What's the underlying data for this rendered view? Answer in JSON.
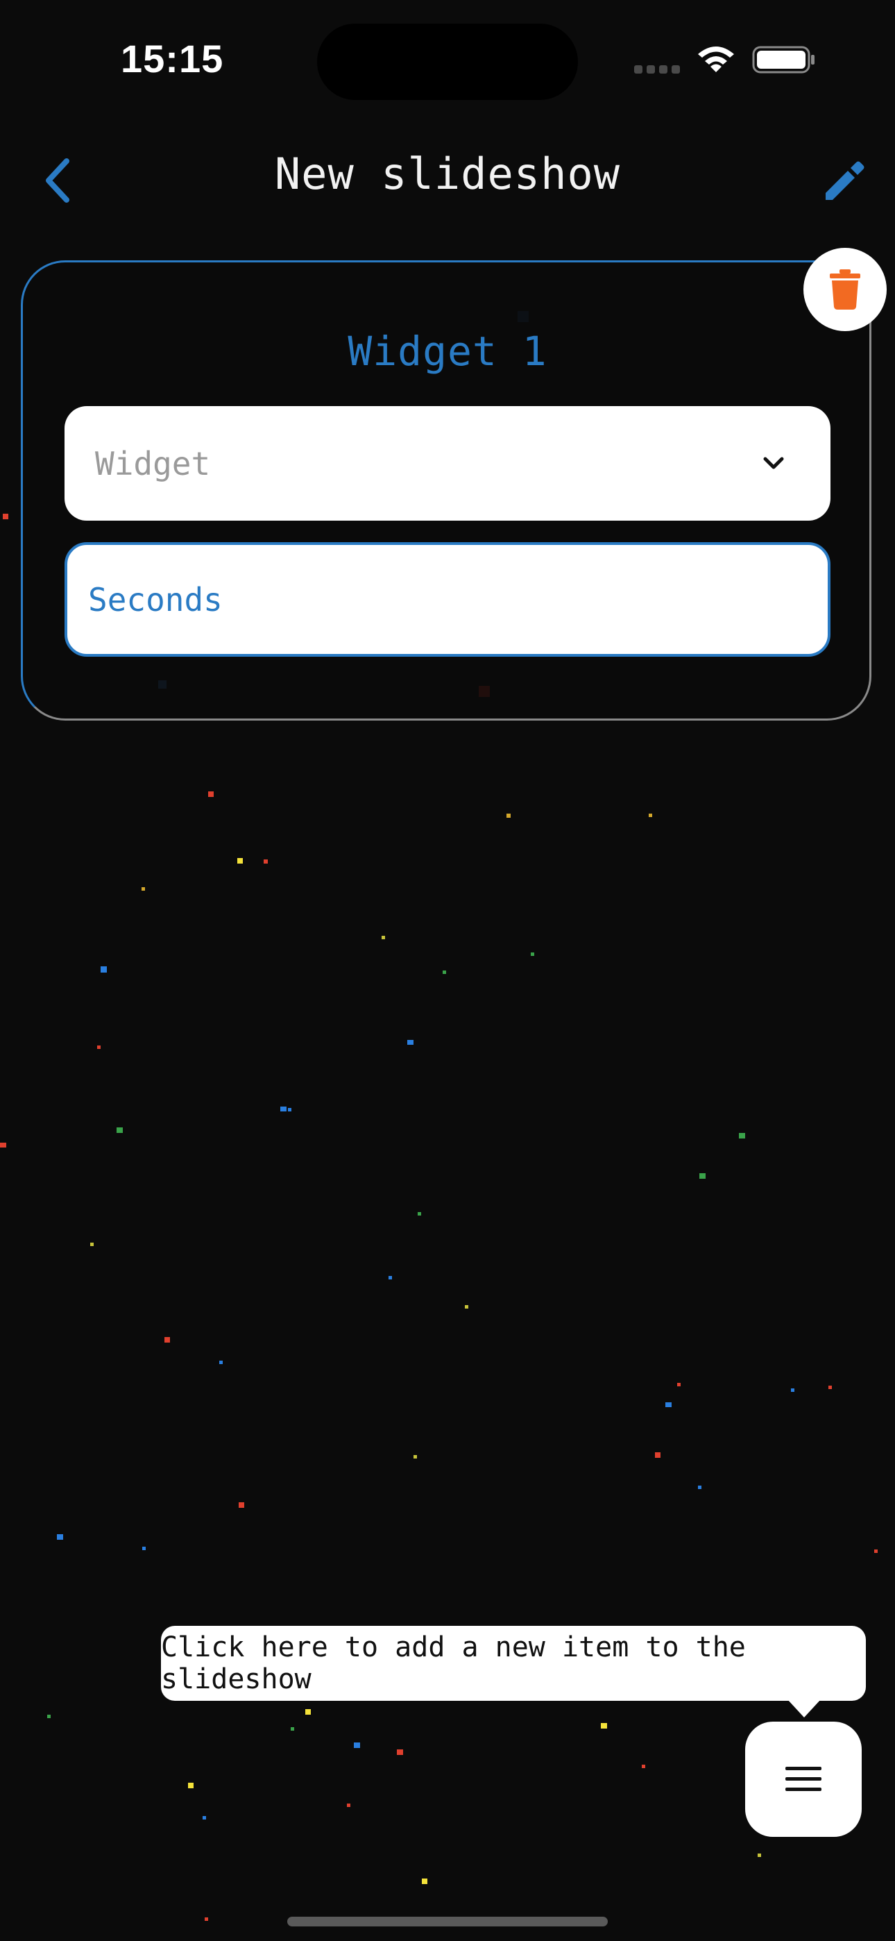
{
  "status_bar": {
    "time": "15:15",
    "icons": [
      "cellular-signal-icon",
      "wifi-icon",
      "battery-icon"
    ]
  },
  "nav": {
    "title": "New slideshow",
    "back_icon": "chevron-left-icon",
    "edit_icon": "pencil-icon"
  },
  "widget_card": {
    "title": "Widget 1",
    "delete_icon": "trash-icon",
    "widget_select": {
      "placeholder": "Widget",
      "chevron_icon": "chevron-down-icon"
    },
    "seconds_input": {
      "placeholder": "Seconds",
      "value": ""
    }
  },
  "tooltip": {
    "text": "Click here to add a new item to the slideshow"
  },
  "fab": {
    "icon": "menu-icon"
  },
  "colors": {
    "background": "#0b0b0b",
    "accent_blue": "#2a7bc4",
    "delete_orange": "#f26a22",
    "white": "#ffffff"
  }
}
